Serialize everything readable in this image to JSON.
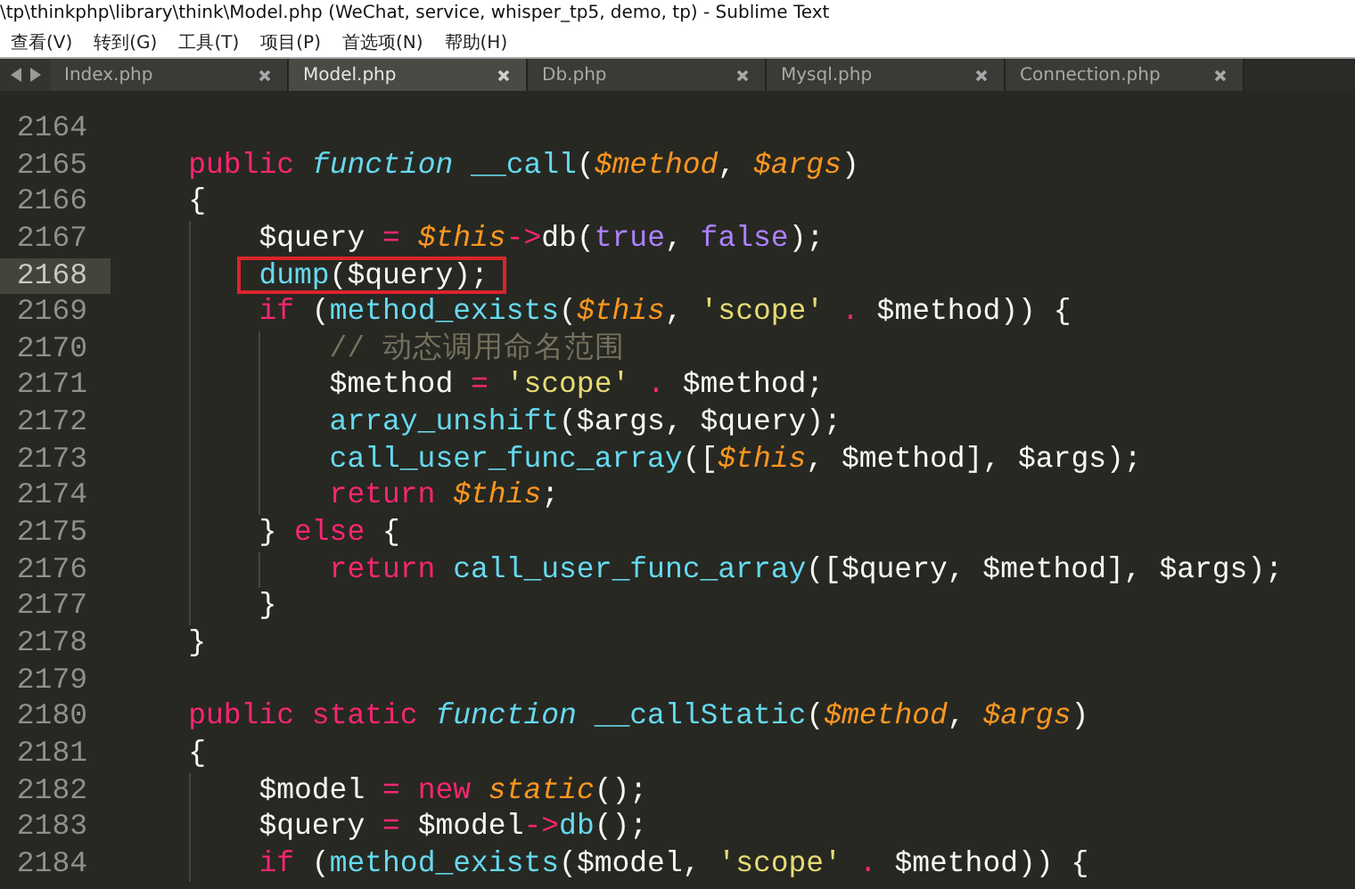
{
  "window": {
    "title": "\\tp\\thinkphp\\library\\think\\Model.php (WeChat, service, whisper_tp5, demo, tp) - Sublime Text"
  },
  "menu": [
    "查看(V)",
    "转到(G)",
    "工具(T)",
    "项目(P)",
    "首选项(N)",
    "帮助(H)"
  ],
  "tabs": [
    {
      "label": "Index.php",
      "selected": false
    },
    {
      "label": "Model.php",
      "selected": true
    },
    {
      "label": "Db.php",
      "selected": false
    },
    {
      "label": "Mysql.php",
      "selected": false
    },
    {
      "label": "Connection.php",
      "selected": false
    }
  ],
  "editor": {
    "lines": [
      {
        "number": "2164",
        "current": false,
        "boxed": false
      },
      {
        "number": "2165",
        "current": false,
        "boxed": false,
        "tokens": [
          {
            "kind": "keyword",
            "text": "public"
          },
          {
            "kind": "storage",
            "text": " function"
          },
          {
            "kind": "function",
            "text": " __call"
          },
          {
            "kind": "plain",
            "text": "("
          },
          {
            "kind": "param",
            "text": "$method"
          },
          {
            "kind": "plain",
            "text": ","
          },
          {
            "kind": "param",
            "text": " $args"
          },
          {
            "kind": "plain",
            "text": ")"
          }
        ]
      },
      {
        "number": "2166",
        "current": false,
        "boxed": false,
        "tokens": [
          {
            "kind": "plain",
            "text": "{"
          }
        ],
        "children": [
          {
            "number": "2167",
            "current": false,
            "boxed": false,
            "tokens": [
              {
                "kind": "plain",
                "text": "$query"
              },
              {
                "kind": "operator",
                "text": " ="
              },
              {
                "kind": "param",
                "text": " $this"
              },
              {
                "kind": "operator",
                "text": "->"
              },
              {
                "kind": "plain",
                "text": "db("
              },
              {
                "kind": "constant",
                "text": "true"
              },
              {
                "kind": "plain",
                "text": ","
              },
              {
                "kind": "constant",
                "text": " false"
              },
              {
                "kind": "plain",
                "text": ");"
              }
            ]
          },
          {
            "number": "2168",
            "current": true,
            "boxed": true,
            "tokens": [
              {
                "kind": "function",
                "text": "dump"
              },
              {
                "kind": "plain",
                "text": "($query);"
              }
            ]
          },
          {
            "number": "2169",
            "current": false,
            "boxed": false,
            "tokens": [
              {
                "kind": "keyword",
                "text": "if"
              },
              {
                "kind": "plain",
                "text": " ("
              },
              {
                "kind": "function",
                "text": "method_exists"
              },
              {
                "kind": "plain",
                "text": "("
              },
              {
                "kind": "param",
                "text": "$this"
              },
              {
                "kind": "plain",
                "text": ","
              },
              {
                "kind": "string",
                "text": " 'scope'"
              },
              {
                "kind": "operator",
                "text": " ."
              },
              {
                "kind": "plain",
                "text": " $method)) {"
              }
            ],
            "children": [
              {
                "number": "2170",
                "current": false,
                "boxed": false,
                "tokens": [
                  {
                    "kind": "comment",
                    "text": "// 动态调用命名范围"
                  }
                ]
              },
              {
                "number": "2171",
                "current": false,
                "boxed": false,
                "tokens": [
                  {
                    "kind": "plain",
                    "text": "$method"
                  },
                  {
                    "kind": "operator",
                    "text": " ="
                  },
                  {
                    "kind": "string",
                    "text": " 'scope'"
                  },
                  {
                    "kind": "operator",
                    "text": " ."
                  },
                  {
                    "kind": "plain",
                    "text": " $method;"
                  }
                ]
              },
              {
                "number": "2172",
                "current": false,
                "boxed": false,
                "tokens": [
                  {
                    "kind": "function",
                    "text": "array_unshift"
                  },
                  {
                    "kind": "plain",
                    "text": "($args, $query);"
                  }
                ]
              },
              {
                "number": "2173",
                "current": false,
                "boxed": false,
                "tokens": [
                  {
                    "kind": "function",
                    "text": "call_user_func_array"
                  },
                  {
                    "kind": "plain",
                    "text": "(["
                  },
                  {
                    "kind": "param",
                    "text": "$this"
                  },
                  {
                    "kind": "plain",
                    "text": ", $method], $args);"
                  }
                ]
              },
              {
                "number": "2174",
                "current": false,
                "boxed": false,
                "tokens": [
                  {
                    "kind": "keyword",
                    "text": "return"
                  },
                  {
                    "kind": "param",
                    "text": " $this"
                  },
                  {
                    "kind": "plain",
                    "text": ";"
                  }
                ]
              }
            ]
          },
          {
            "number": "2175",
            "current": false,
            "boxed": false,
            "tokens": [
              {
                "kind": "plain",
                "text": "}"
              },
              {
                "kind": "keyword",
                "text": " else"
              },
              {
                "kind": "plain",
                "text": " {"
              }
            ],
            "children": [
              {
                "number": "2176",
                "current": false,
                "boxed": false,
                "tokens": [
                  {
                    "kind": "keyword",
                    "text": "return"
                  },
                  {
                    "kind": "function",
                    "text": " call_user_func_array"
                  },
                  {
                    "kind": "plain",
                    "text": "([$query, $method], $args);"
                  }
                ]
              }
            ]
          },
          {
            "number": "2177",
            "current": false,
            "boxed": false,
            "tokens": [
              {
                "kind": "plain",
                "text": "}"
              }
            ]
          }
        ]
      },
      {
        "number": "2178",
        "current": false,
        "boxed": false,
        "tokens": [
          {
            "kind": "plain",
            "text": "}"
          }
        ]
      },
      {
        "number": "2179",
        "current": false,
        "boxed": false
      },
      {
        "number": "2180",
        "current": false,
        "boxed": false,
        "tokens": [
          {
            "kind": "keyword",
            "text": "public"
          },
          {
            "kind": "keyword",
            "text": " static"
          },
          {
            "kind": "storage",
            "text": " function"
          },
          {
            "kind": "function",
            "text": " __callStatic"
          },
          {
            "kind": "plain",
            "text": "("
          },
          {
            "kind": "param",
            "text": "$method"
          },
          {
            "kind": "plain",
            "text": ","
          },
          {
            "kind": "param",
            "text": " $args"
          },
          {
            "kind": "plain",
            "text": ")"
          }
        ]
      },
      {
        "number": "2181",
        "current": false,
        "boxed": false,
        "tokens": [
          {
            "kind": "plain",
            "text": "{"
          }
        ],
        "children": [
          {
            "number": "2182",
            "current": false,
            "boxed": false,
            "tokens": [
              {
                "kind": "plain",
                "text": "$model"
              },
              {
                "kind": "operator",
                "text": " ="
              },
              {
                "kind": "keyword",
                "text": " new"
              },
              {
                "kind": "class",
                "text": " static"
              },
              {
                "kind": "plain",
                "text": "();"
              }
            ]
          },
          {
            "number": "2183",
            "current": false,
            "boxed": false,
            "tokens": [
              {
                "kind": "plain",
                "text": "$query"
              },
              {
                "kind": "operator",
                "text": " ="
              },
              {
                "kind": "plain",
                "text": " $model"
              },
              {
                "kind": "operator",
                "text": "->"
              },
              {
                "kind": "function",
                "text": "db"
              },
              {
                "kind": "plain",
                "text": "();"
              }
            ]
          },
          {
            "number": "2184",
            "current": false,
            "boxed": false,
            "tokens": [
              {
                "kind": "keyword",
                "text": "if"
              },
              {
                "kind": "plain",
                "text": " ("
              },
              {
                "kind": "function",
                "text": "method_exists"
              },
              {
                "kind": "plain",
                "text": "($model,"
              },
              {
                "kind": "string",
                "text": " 'scope'"
              },
              {
                "kind": "operator",
                "text": " ."
              },
              {
                "kind": "plain",
                "text": " $method)) {"
              }
            ]
          }
        ]
      }
    ]
  }
}
